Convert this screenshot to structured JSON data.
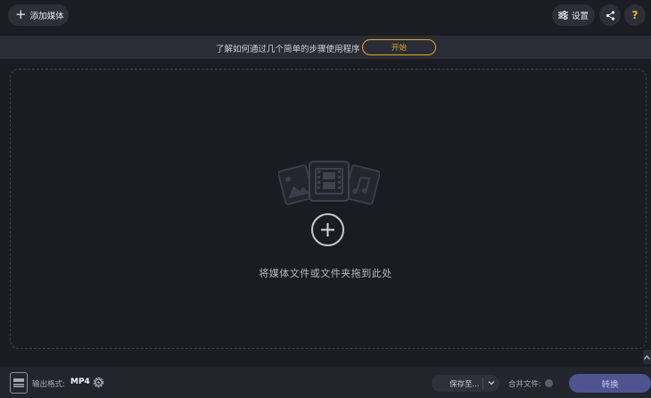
{
  "toolbar": {
    "add_media_label": "添加媒体",
    "settings_label": "设置"
  },
  "banner": {
    "text": "了解如何通过几个简单的步骤使用程序",
    "start_label": "开始"
  },
  "dropzone": {
    "hint": "将媒体文件或文件夹拖到此处"
  },
  "bottombar": {
    "format_label": "输出格式:",
    "format_value": "MP4",
    "save_to_label": "保存至...",
    "merge_label": "合并文件:",
    "convert_label": "转换"
  },
  "icons": {
    "add": "plus-icon",
    "settings": "sliders-icon",
    "share": "share-icon",
    "help": "question-icon",
    "media": "media-files-icon",
    "format_gear": "gear-icon",
    "save_chevron": "chevron-down-icon",
    "collapse": "chevron-up-icon"
  },
  "colors": {
    "accent_orange": "#e3a92a",
    "help_yellow": "#f2b21c",
    "convert_bg": "#4d5490",
    "background": "#1a1c22"
  }
}
